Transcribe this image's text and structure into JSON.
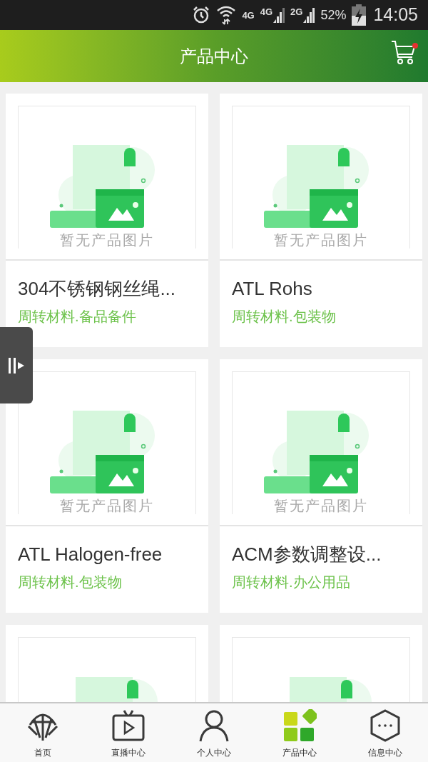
{
  "status_bar": {
    "network_1": "4G",
    "network_2": "4G",
    "network_3": "2G",
    "battery": "52%",
    "time": "14:05"
  },
  "header": {
    "title": "产品中心",
    "cart_badge": true
  },
  "products": [
    {
      "kind": "product",
      "image_caption": "暂无产品图片",
      "name": "304不锈钢钢丝绳...",
      "category": "周转材料.备品备件"
    },
    {
      "kind": "product",
      "image_caption": "暂无产品图片",
      "name": "ATL Rohs",
      "category": "周转材料.包装物"
    },
    {
      "kind": "product",
      "image_caption": "暂无产品图片",
      "name": "ATL Halogen-free",
      "category": "周转材料.包装物"
    },
    {
      "kind": "product",
      "image_caption": "暂无产品图片",
      "name": "ACM参数调整设...",
      "category": "周转材料.办公用品"
    },
    {
      "kind": "product"
    },
    {
      "kind": "product"
    }
  ],
  "bottom_nav": [
    {
      "label": "首页",
      "selected": false
    },
    {
      "label": "直播中心",
      "selected": false
    },
    {
      "label": "个人中心",
      "selected": false
    },
    {
      "label": "产品中心",
      "selected": true
    },
    {
      "label": "信息中心",
      "selected": false
    }
  ]
}
